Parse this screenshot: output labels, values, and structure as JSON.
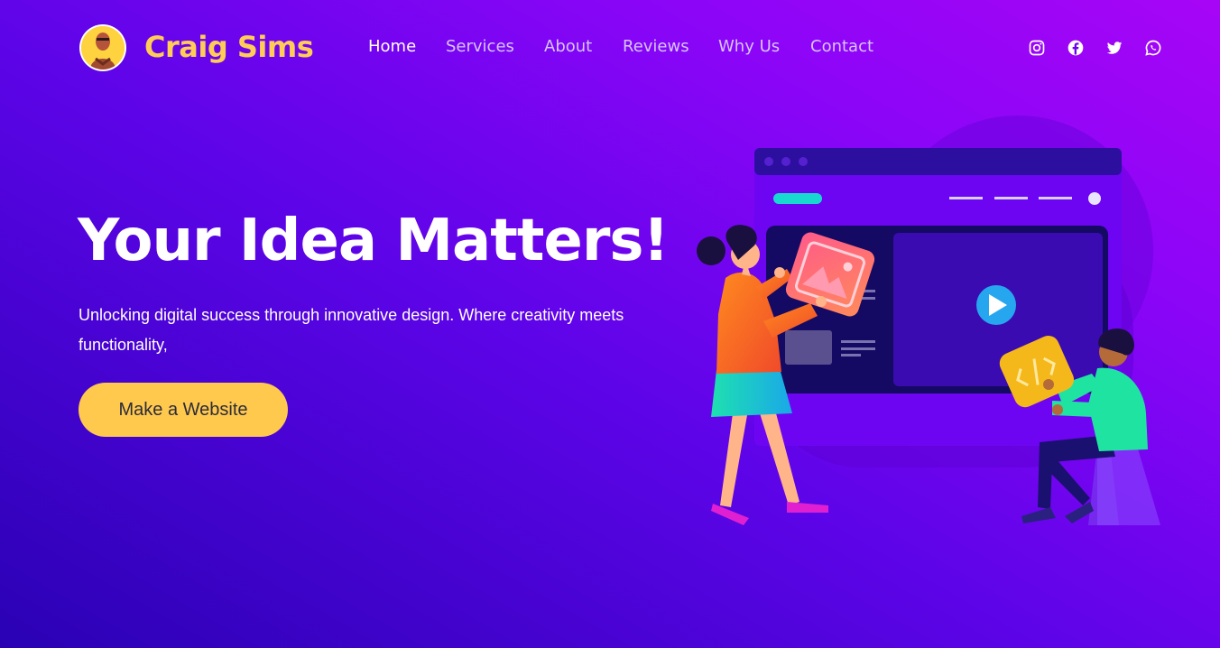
{
  "brand": {
    "name": "Craig Sims",
    "avatar_icon": "person-avatar"
  },
  "nav": {
    "items": [
      {
        "label": "Home",
        "active": true
      },
      {
        "label": "Services",
        "active": false
      },
      {
        "label": "About",
        "active": false
      },
      {
        "label": "Reviews",
        "active": false
      },
      {
        "label": "Why Us",
        "active": false
      },
      {
        "label": "Contact",
        "active": false
      }
    ]
  },
  "social": [
    "instagram-icon",
    "facebook-icon",
    "twitter-icon",
    "whatsapp-icon"
  ],
  "hero": {
    "title": "Your Idea Matters!",
    "subtitle": "Unlocking digital success through innovative design. Where creativity meets functionality,",
    "cta_label": "Make a Website"
  },
  "colors": {
    "bg_start": "#2a02b4",
    "bg_end": "#a705f6",
    "brand": "#ffcc55",
    "cta": "#ffc94d",
    "nav_text": "#d6c5ff",
    "nav_active": "#ffffff"
  }
}
